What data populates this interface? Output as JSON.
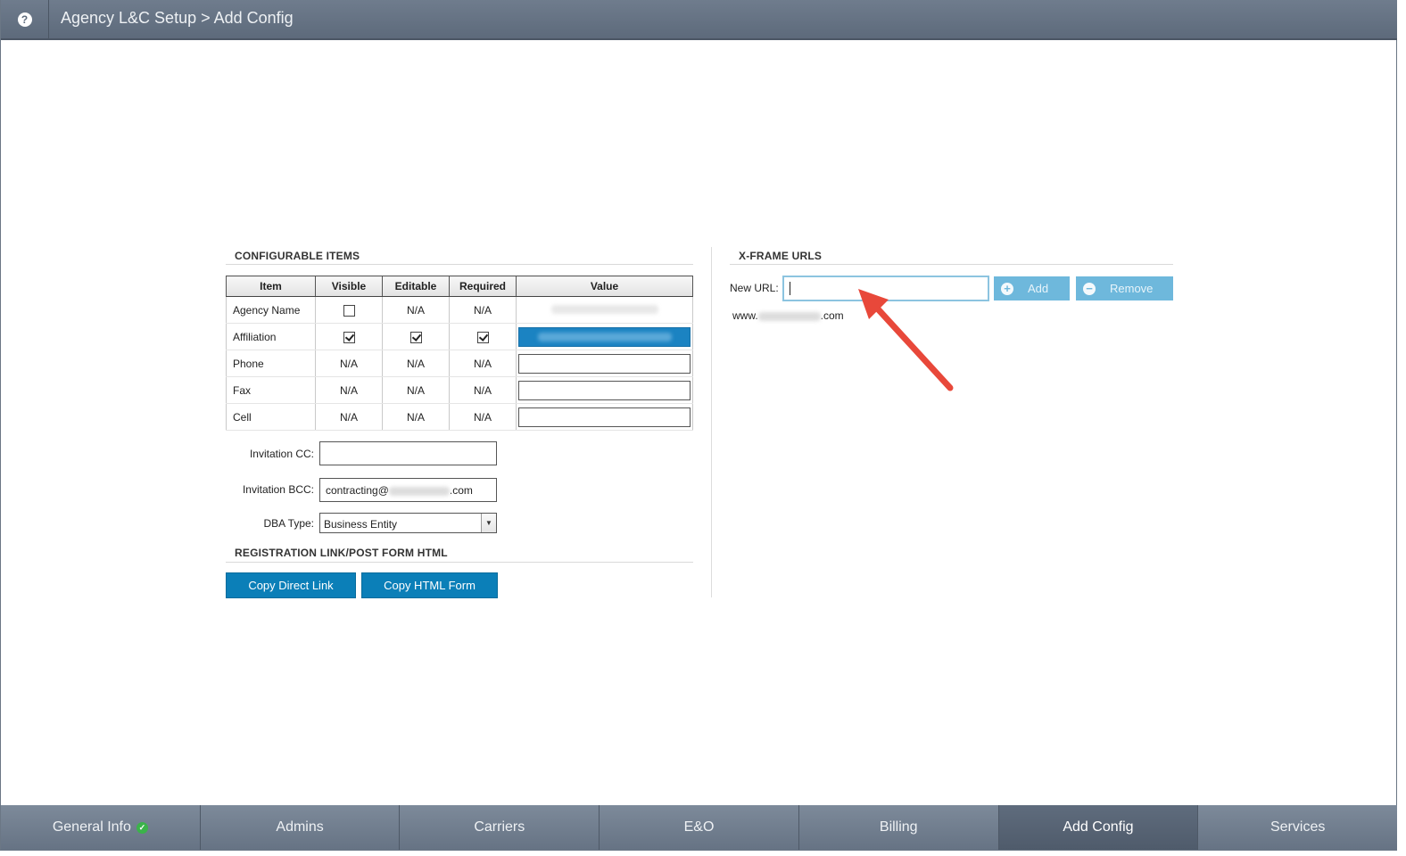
{
  "header": {
    "help_icon": "?",
    "breadcrumb": "Agency L&C Setup > Add Config"
  },
  "configurable": {
    "title": "CONFIGURABLE ITEMS",
    "columns": [
      "Item",
      "Visible",
      "Editable",
      "Required",
      "Value"
    ],
    "rows": [
      {
        "item": "Agency Name",
        "visible": "checkbox-unchecked",
        "editable": "N/A",
        "required": "N/A",
        "value": "redacted"
      },
      {
        "item": "Affiliation",
        "visible": "checkbox-checked",
        "editable": "checkbox-checked",
        "required": "checkbox-checked",
        "value": "redacted-selected"
      },
      {
        "item": "Phone",
        "visible": "N/A",
        "editable": "N/A",
        "required": "N/A",
        "value": ""
      },
      {
        "item": "Fax",
        "visible": "N/A",
        "editable": "N/A",
        "required": "N/A",
        "value": ""
      },
      {
        "item": "Cell",
        "visible": "N/A",
        "editable": "N/A",
        "required": "N/A",
        "value": ""
      }
    ],
    "na": "N/A"
  },
  "invitation": {
    "cc_label": "Invitation CC:",
    "cc_value": "",
    "bcc_label": "Invitation BCC:",
    "bcc_prefix": "contracting@",
    "bcc_suffix": ".com"
  },
  "dba": {
    "label": "DBA Type:",
    "selected": "Business Entity"
  },
  "registration": {
    "title": "REGISTRATION LINK/POST FORM HTML",
    "copy_link": "Copy Direct Link",
    "copy_form": "Copy HTML Form"
  },
  "xframe": {
    "title": "X-FRAME URLS",
    "new_url_label": "New URL:",
    "new_url_value": "",
    "add_label": "Add",
    "remove_label": "Remove",
    "url_prefix": "www.",
    "url_suffix": ".com"
  },
  "tabs": [
    "General Info",
    "Admins",
    "Carriers",
    "E&O",
    "Billing",
    "Add Config",
    "Services"
  ],
  "active_tab": "Add Config",
  "colors": {
    "header": "#5d6a7b",
    "primary_button": "#0b7fb8",
    "disabled_button": "#6eb8dc",
    "annotation_arrow": "#e8483a",
    "status_ok": "#3bb34a"
  }
}
